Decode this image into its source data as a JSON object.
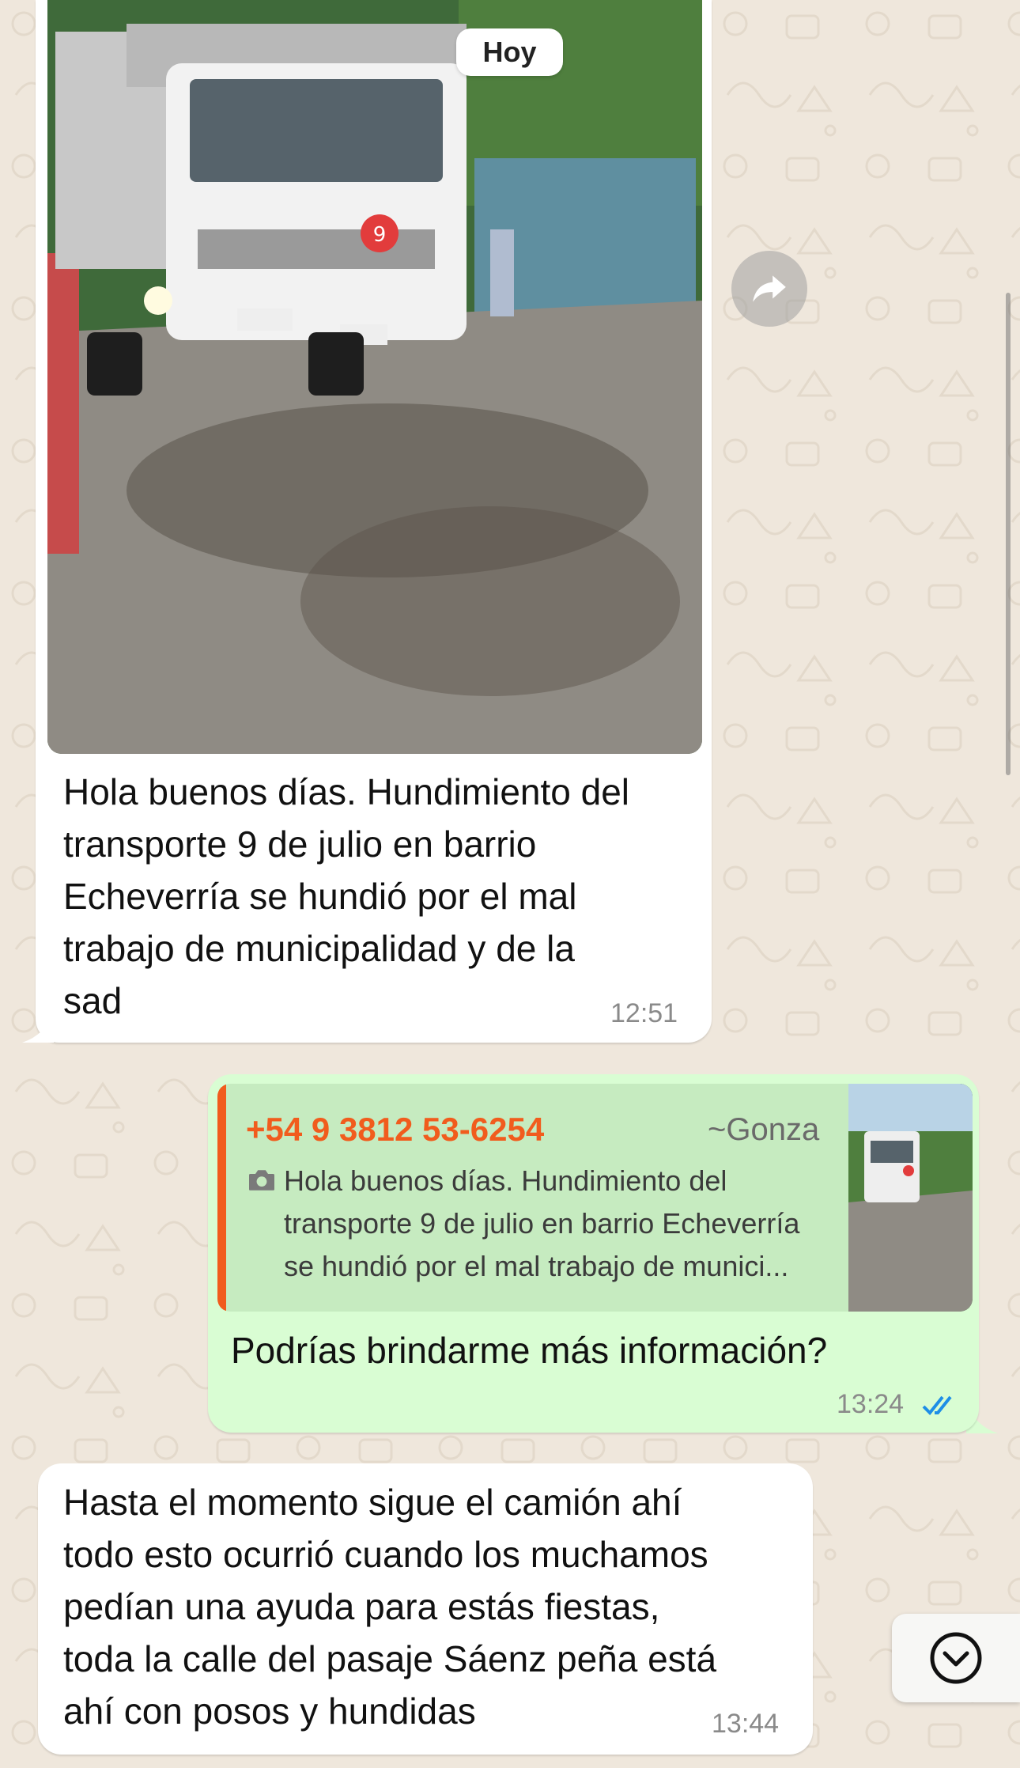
{
  "chat": {
    "date_label": "Hoy",
    "messages": [
      {
        "direction": "incoming",
        "has_image": true,
        "image_description_icon": "truck-photo",
        "text": "Hola buenos días. Hundimiento del\ntransporte 9 de julio en barrio\nEcheverría se hundió por el mal\ntrabajo de municipalidad y de la\nsad",
        "time": "12:51"
      },
      {
        "direction": "outgoing",
        "quote": {
          "sender_phone": "+54 9 3812 53-6254",
          "sender_name": "~Gonza",
          "text": "Hola buenos días. Hundimiento del\ntransporte 9 de julio en barrio Echeverría\nse hundió por el mal trabajo de munici...",
          "icon": "camera-icon"
        },
        "text": "Podrías brindarme más información?",
        "time": "13:24",
        "status": "read"
      },
      {
        "direction": "incoming",
        "text": "Hasta el momento sigue el camión ahí\ntodo esto ocurrió cuando los muchamos\npedían una ayuda para estás fiestas,\ntoda la calle del pasaje Sáenz peña está\nahí con posos y hundidas",
        "time": "13:44"
      }
    ]
  },
  "colors": {
    "background": "#efe7dc",
    "incoming_bubble": "#ffffff",
    "outgoing_bubble": "#d9fdd3",
    "quote_accent": "#f15c1d",
    "read_ticks": "#1e8ee6"
  },
  "icons": {
    "forward": "forward-icon",
    "scroll_down": "chevron-down-icon",
    "read_receipt": "double-check-icon"
  }
}
